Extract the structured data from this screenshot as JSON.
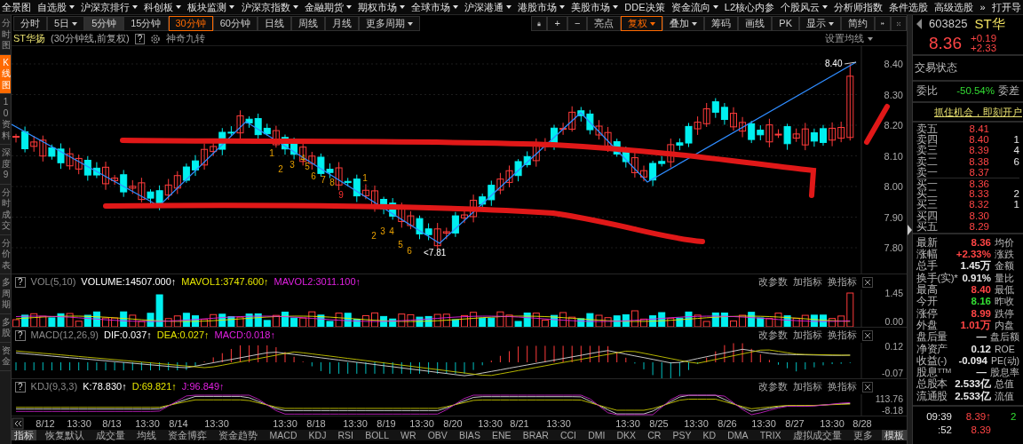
{
  "top_menu": [
    {
      "label": "全景图",
      "dropdown": false
    },
    {
      "label": "自选股",
      "dropdown": true
    },
    {
      "label": "沪深京排行",
      "dropdown": true
    },
    {
      "label": "科创板",
      "dropdown": true
    },
    {
      "label": "板块监测",
      "dropdown": true
    },
    {
      "label": "沪深京指数",
      "dropdown": true
    },
    {
      "label": "金融期货",
      "dropdown": true
    },
    {
      "label": "期权市场",
      "dropdown": true
    },
    {
      "label": "全球市场",
      "dropdown": true
    },
    {
      "label": "沪深港通",
      "dropdown": true
    },
    {
      "label": "港股市场",
      "dropdown": true
    },
    {
      "label": "美股市场",
      "dropdown": true
    },
    {
      "label": "DDE决策",
      "dropdown": false
    },
    {
      "label": "资金流向",
      "dropdown": true
    },
    {
      "label": "L2核心内参",
      "dropdown": false
    },
    {
      "label": "个股风云",
      "dropdown": true
    },
    {
      "label": "分析师指数",
      "dropdown": false
    },
    {
      "label": "条件选股",
      "dropdown": false
    },
    {
      "label": "高级选股",
      "dropdown": false
    },
    {
      "label": "»",
      "dropdown": false
    },
    {
      "label": "打开导",
      "dropdown": false
    }
  ],
  "side_tabs": [
    {
      "label": "分时图",
      "selected": false
    },
    {
      "label": "K线图",
      "selected": true
    },
    {
      "label": "10资料",
      "selected": false
    },
    {
      "label": "深度9",
      "selected": false
    },
    {
      "label": "分时成交",
      "selected": false
    },
    {
      "label": "分价表",
      "selected": false
    },
    {
      "label": "多周期",
      "selected": false
    },
    {
      "label": "多股",
      "selected": false
    },
    {
      "label": "资金",
      "selected": false
    }
  ],
  "period_tabs": [
    {
      "label": "分时",
      "dropdown": false,
      "selected": false,
      "hover": false
    },
    {
      "label": "5日",
      "dropdown": true,
      "selected": false,
      "hover": false
    },
    {
      "label": "5分钟",
      "dropdown": false,
      "selected": false,
      "hover": true
    },
    {
      "label": "15分钟",
      "dropdown": false,
      "selected": false,
      "hover": false
    },
    {
      "label": "30分钟",
      "dropdown": false,
      "selected": true,
      "hover": false
    },
    {
      "label": "60分钟",
      "dropdown": false,
      "selected": false,
      "hover": false
    },
    {
      "label": "日线",
      "dropdown": false,
      "selected": false,
      "hover": false
    },
    {
      "label": "周线",
      "dropdown": false,
      "selected": false,
      "hover": false
    },
    {
      "label": "月线",
      "dropdown": false,
      "selected": false,
      "hover": false
    },
    {
      "label": "更多周期",
      "dropdown": true,
      "selected": false,
      "hover": false
    }
  ],
  "tool_buttons": [
    {
      "label": "+",
      "dropdown": false,
      "selected": false
    },
    {
      "label": "−",
      "dropdown": false,
      "selected": false
    },
    {
      "label": "亮点",
      "dropdown": false,
      "selected": false
    },
    {
      "label": "复权",
      "dropdown": true,
      "selected": true
    },
    {
      "label": "叠加",
      "dropdown": true,
      "selected": false
    },
    {
      "label": "筹码",
      "dropdown": false,
      "selected": false
    },
    {
      "label": "画线",
      "dropdown": false,
      "selected": false
    },
    {
      "label": "PK",
      "dropdown": false,
      "selected": false
    },
    {
      "label": "显示",
      "dropdown": true,
      "selected": false
    },
    {
      "label": "简约",
      "dropdown": false,
      "selected": false
    }
  ],
  "chart_title": {
    "name": "ST华扬",
    "period": "(30分钟线,前复权)",
    "help": "?",
    "feature": "神奇九转",
    "ma_setting": "设置均线"
  },
  "price_axis": [
    "8.40",
    "8.30",
    "8.20",
    "8.10",
    "8.00",
    "7.90",
    "7.80"
  ],
  "peak_label": "8.40",
  "low_label": "<7.81",
  "nine_turn_marks": [
    {
      "text": "1",
      "highlight": false
    },
    {
      "text": "2",
      "highlight": false
    },
    {
      "text": "3",
      "highlight": false
    },
    {
      "text": "4",
      "highlight": false
    },
    {
      "text": "5",
      "highlight": false
    },
    {
      "text": "6",
      "highlight": false
    },
    {
      "text": "7",
      "highlight": false
    },
    {
      "text": "8",
      "highlight": false
    },
    {
      "text": "9",
      "highlight": true
    },
    {
      "text": "1",
      "highlight": false
    },
    {
      "text": "2",
      "highlight": false
    },
    {
      "text": "3",
      "highlight": false
    },
    {
      "text": "4",
      "highlight": false
    },
    {
      "text": "5",
      "highlight": false
    },
    {
      "text": "6",
      "highlight": false
    }
  ],
  "panels": [
    {
      "kind": "vol",
      "help": "?",
      "segments": [
        {
          "text": "VOL(5,10)",
          "color": "#8a8a8a"
        },
        {
          "text": "VOLUME:14507.000↑",
          "color": "#ffffff"
        },
        {
          "text": "MAVOL1:3747.600↑",
          "color": "#e6e600"
        },
        {
          "text": "MAVOL2:3011.100↑",
          "color": "#e020e0"
        }
      ],
      "actions": [
        "改参数",
        "加指标",
        "换指标"
      ],
      "axis": [
        "1.45",
        "0.00"
      ]
    },
    {
      "kind": "macd",
      "help": "?",
      "segments": [
        {
          "text": "MACD(12,26,9)",
          "color": "#8a8a8a"
        },
        {
          "text": "DIF:0.037↑",
          "color": "#ffffff"
        },
        {
          "text": "DEA:0.027↑",
          "color": "#e6e600"
        },
        {
          "text": "MACD:0.018↑",
          "color": "#e020e0"
        }
      ],
      "actions": [
        "改参数",
        "加指标",
        "换指标"
      ],
      "axis": [
        "0.12",
        "-0.07"
      ]
    },
    {
      "kind": "kdj",
      "help": "?",
      "segments": [
        {
          "text": "KDJ(9,3,3)",
          "color": "#8a8a8a"
        },
        {
          "text": "K:78.830↑",
          "color": "#ffffff"
        },
        {
          "text": "D:69.821↑",
          "color": "#e6e600"
        },
        {
          "text": "J:96.849↑",
          "color": "#e020e0"
        }
      ],
      "actions": [
        "改参数",
        "加指标",
        "换指标"
      ],
      "axis": [
        "113.76",
        "-8.18"
      ]
    }
  ],
  "time_axis": [
    "8/12",
    "13:30",
    "8/13",
    "13:30",
    "8/14",
    "13:30",
    "13:30",
    "8/18",
    "13:30",
    "8/19",
    "13:30",
    "8/20",
    "13:30",
    "8/21",
    "13:30",
    "13:30",
    "8/25",
    "13:30",
    "8/26",
    "13:30",
    "8/27",
    "13:30",
    "8/28"
  ],
  "bottom_tabs": [
    {
      "label": "指标",
      "selected": true
    },
    {
      "label": "恢复默认",
      "selected": false
    },
    {
      "label": "成交量",
      "selected": false
    },
    {
      "label": "均线",
      "selected": false
    },
    {
      "label": "资金博弈",
      "selected": false
    },
    {
      "label": "资金趋势",
      "selected": false
    },
    {
      "label": "MACD",
      "selected": false
    },
    {
      "label": "KDJ",
      "selected": false
    },
    {
      "label": "RSI",
      "selected": false
    },
    {
      "label": "BOLL",
      "selected": false
    },
    {
      "label": "WR",
      "selected": false
    },
    {
      "label": "OBV",
      "selected": false
    },
    {
      "label": "BIAS",
      "selected": false
    },
    {
      "label": "ENE",
      "selected": false
    },
    {
      "label": "BRAR",
      "selected": false
    },
    {
      "label": "CCI",
      "selected": false
    },
    {
      "label": "DMI",
      "selected": false
    },
    {
      "label": "DKX",
      "selected": false
    },
    {
      "label": "CR",
      "selected": false
    },
    {
      "label": "PSY",
      "selected": false
    },
    {
      "label": "KD",
      "selected": false
    },
    {
      "label": "DMA",
      "selected": false
    },
    {
      "label": "TRIX",
      "selected": false
    },
    {
      "label": "虚拟成交量",
      "selected": false
    },
    {
      "label": "更多",
      "selected": false
    },
    {
      "label": "模板",
      "selected": true
    }
  ],
  "quote": {
    "code": "603825",
    "name": "ST华",
    "price": "8.36",
    "change": "+0.19",
    "change_pct": "+2.33",
    "status": "交易状态",
    "ratio_label": "委比",
    "ratio": "-50.54%",
    "diff_label": "委差",
    "ad": "抓住机会，即刻开户"
  },
  "order_book": [
    {
      "label": "卖五",
      "price": "8.41"
    },
    {
      "label": "卖四",
      "price": "8.40",
      "volume": "1"
    },
    {
      "label": "卖三",
      "price": "8.39",
      "volume": "4"
    },
    {
      "label": "卖二",
      "price": "8.38",
      "volume": "6"
    },
    {
      "label": "卖一",
      "price": "8.37"
    },
    {
      "label": "买一",
      "price": "8.36"
    },
    {
      "label": "买二",
      "price": "8.33",
      "volume": "2"
    },
    {
      "label": "买三",
      "price": "8.32",
      "volume": "1"
    },
    {
      "label": "买四",
      "price": "8.30"
    },
    {
      "label": "买五",
      "price": "8.29"
    }
  ],
  "stats": [
    {
      "label": "最新",
      "value": "8.36",
      "color": "#ff4545",
      "label2": "均价"
    },
    {
      "label": "涨幅",
      "value": "+2.33%",
      "color": "#ff4545",
      "label2": "涨跌"
    },
    {
      "label": "总手",
      "value": "1.45万",
      "color": "#e8e8e8",
      "label2": "金额"
    },
    {
      "label": "换手(实)*",
      "value": "0.91%",
      "color": "#e8e8e8",
      "label2": "量比"
    },
    {
      "label": "最高",
      "value": "8.40",
      "color": "#ff4545",
      "label2": "最低"
    },
    {
      "label": "今开",
      "value": "8.16",
      "color": "#33dd33",
      "label2": "昨收"
    },
    {
      "label": "涨停",
      "value": "8.99",
      "color": "#ff4545",
      "label2": "跌停"
    },
    {
      "label": "外盘",
      "value": "1.01万",
      "color": "#ff4545",
      "label2": "内盘"
    },
    {
      "label": "盘后量",
      "value": "—",
      "color": "#e8e8e8",
      "label2": "盘后额"
    },
    {
      "label": "净资产",
      "value": "0.12",
      "color": "#e8e8e8",
      "label2": "ROE"
    },
    {
      "label": "收益(-)",
      "value": "-0.094",
      "color": "#e8e8e8",
      "label2": "PE(动)"
    },
    {
      "label": "股息$^{TTM}$",
      "value": "—",
      "color": "#e8e8e8",
      "label2": "股息率"
    },
    {
      "label": "总股本",
      "value": "2.533亿",
      "color": "#e8e8e8",
      "label2": "总值"
    },
    {
      "label": "流通股",
      "value": "2.533亿",
      "color": "#e8e8e8",
      "label2": "流值"
    }
  ],
  "ticks": [
    {
      "time": "09:39",
      "price": "8.39",
      "arrow": "↑",
      "volume": "2"
    },
    {
      "time": ":52",
      "price": "8.39"
    }
  ]
}
